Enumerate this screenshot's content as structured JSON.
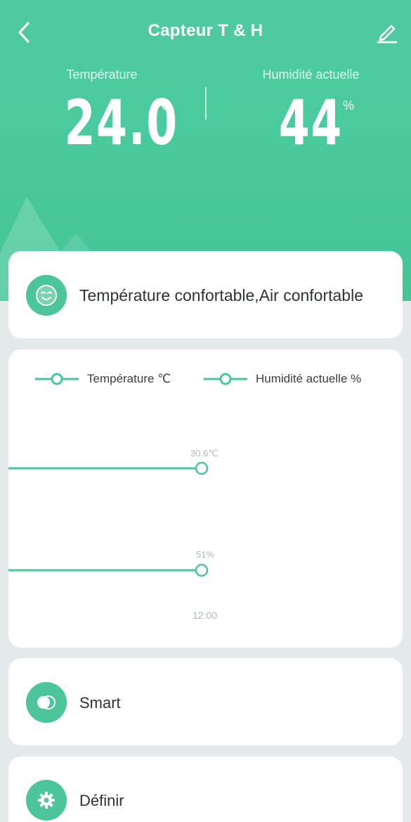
{
  "header": {
    "title": "Capteur T & H",
    "back_icon": "chevron-left-icon",
    "edit_icon": "pencil-icon"
  },
  "readings": {
    "temperature": {
      "label": "Température",
      "value": "24.0",
      "unit": "℃"
    },
    "humidity": {
      "label": "Humidité actuelle",
      "value": "44",
      "unit": "%"
    }
  },
  "status": {
    "icon": "smiley-face-icon",
    "text": "Température confortable,Air confortable"
  },
  "chart_data": {
    "type": "line",
    "series": [
      {
        "name": "Température ℃",
        "values": [
          30.6
        ],
        "value_label": "30.6℃"
      },
      {
        "name": "Humidité actuelle %",
        "values": [
          51
        ],
        "value_label": "51%"
      }
    ],
    "x": [
      "12:00"
    ],
    "xlabel": "",
    "ylabel": "",
    "legend": "top",
    "color": "#4cc59a"
  },
  "menu": [
    {
      "label": "Smart",
      "icon": "toggle-icon"
    },
    {
      "label": "Définir",
      "icon": "gear-icon"
    }
  ],
  "colors": {
    "accent": "#4cc59a",
    "hero": "#4ec9a0",
    "background": "#e4e9ec"
  }
}
